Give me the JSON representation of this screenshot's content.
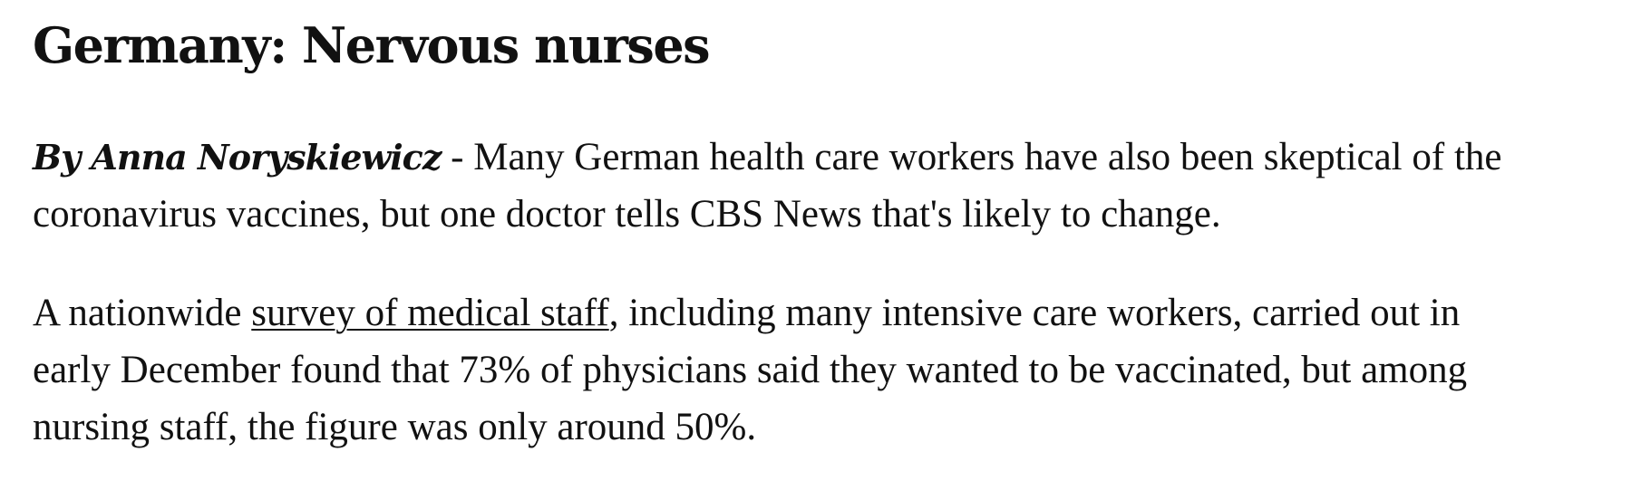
{
  "article": {
    "headline": "Germany: Nervous nurses",
    "byline": "By Anna Noryskiewicz",
    "byline_separator": " - ",
    "paragraph1": {
      "line1": "Many German health care workers have also been skeptical of the",
      "line2": "coronavirus vaccines, but one doctor tells CBS News that's likely to change."
    },
    "paragraph2": {
      "before_link": "A nationwide ",
      "link_text": "survey of medical staff",
      "after_link": ", including many intensive care workers, carried out in",
      "line2": "early December found that 73% of physicians said they wanted to be vaccinated, but among",
      "line3": "nursing staff, the figure was only around 50%."
    }
  }
}
